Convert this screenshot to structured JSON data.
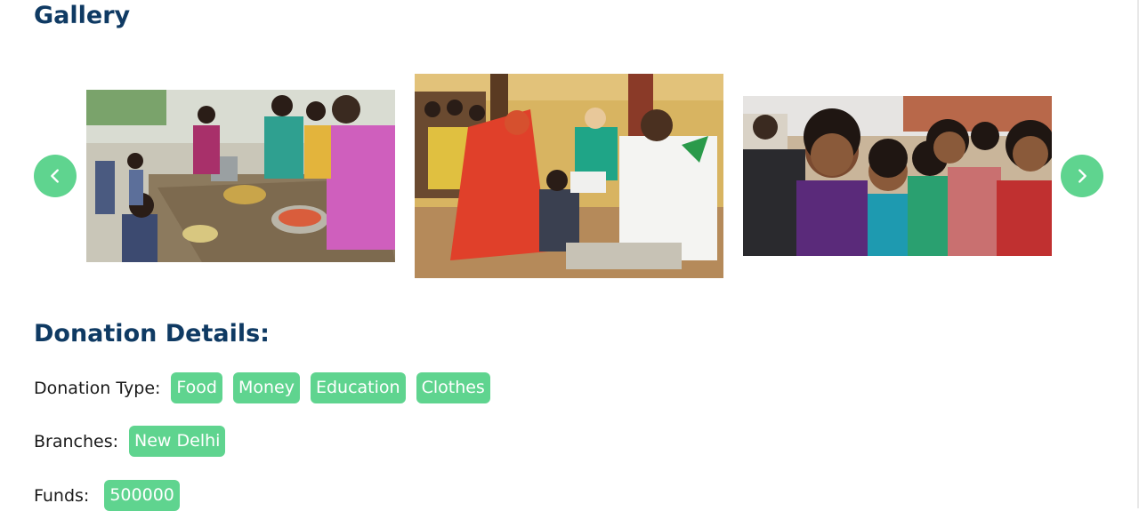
{
  "gallery": {
    "title": "Gallery",
    "prev_icon": "chevron-left-icon",
    "next_icon": "chevron-right-icon",
    "photos": [
      "food-distribution-photo",
      "medical-camp-photo",
      "smiling-children-photo"
    ]
  },
  "donation": {
    "title": "Donation Details:",
    "type_label": "Donation Type:",
    "types": [
      "Food",
      "Money",
      "Education",
      "Clothes"
    ],
    "branches_label": "Branches:",
    "branches": [
      "New Delhi"
    ],
    "funds_label": "Funds:",
    "funds": "500000"
  },
  "colors": {
    "accent": "#5fd48f",
    "heading": "#0f3a63"
  }
}
